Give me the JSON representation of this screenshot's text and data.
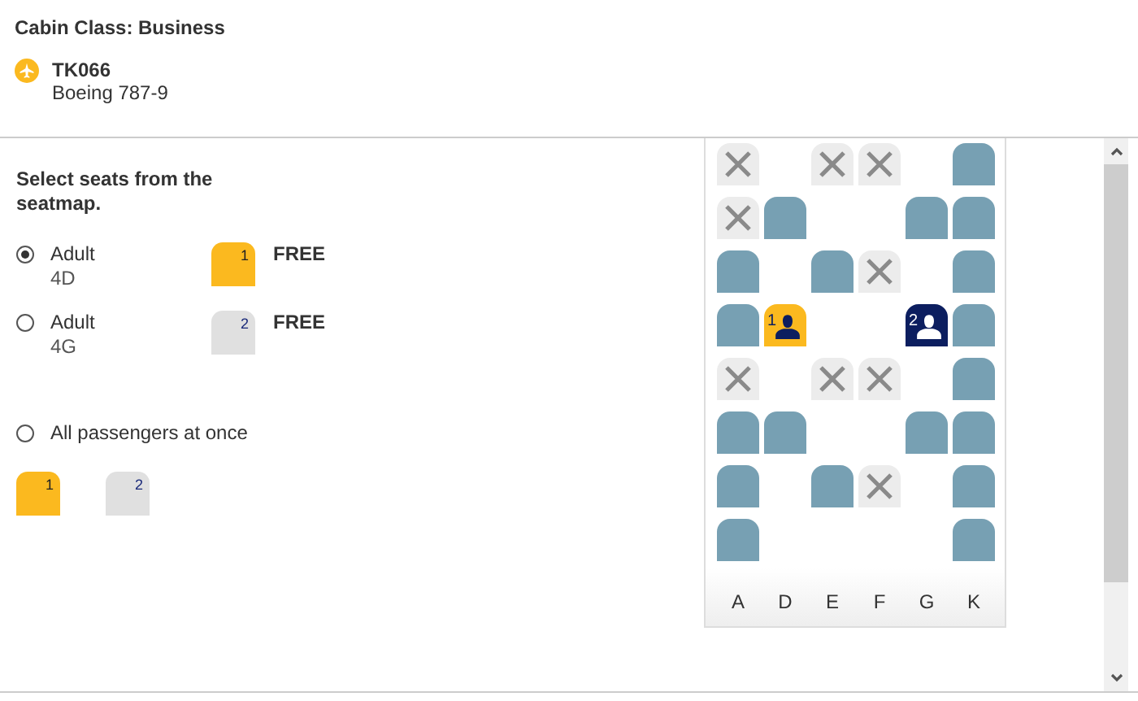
{
  "header": {
    "cabin_class": "Cabin Class: Business",
    "flight": {
      "number": "TK066",
      "aircraft": "Boeing 787-9"
    }
  },
  "instructions": "Select seats from the seatmap.",
  "passengers": [
    {
      "type": "Adult",
      "seat": "4D",
      "number": "1",
      "price": "FREE",
      "selected": true
    },
    {
      "type": "Adult",
      "seat": "4G",
      "number": "2",
      "price": "FREE",
      "selected": false
    }
  ],
  "all_passengers": {
    "label": "All passengers at once",
    "selected": false
  },
  "group_tiles": [
    {
      "number": "1",
      "selected": true
    },
    {
      "number": "2",
      "selected": false
    }
  ],
  "seatmap": {
    "seat_rows": [
      [
        {
          "kind": "occupied"
        },
        {
          "kind": "aisle"
        },
        {
          "kind": "occupied"
        },
        {
          "kind": "occupied"
        },
        {
          "kind": "aisle"
        },
        {
          "kind": "free"
        }
      ],
      [
        {
          "kind": "occupied"
        },
        {
          "kind": "free"
        },
        {
          "kind": "aisle"
        },
        {
          "kind": "aisle"
        },
        {
          "kind": "free"
        },
        {
          "kind": "free"
        }
      ],
      [
        {
          "kind": "free"
        },
        {
          "kind": "aisle"
        },
        {
          "kind": "free"
        },
        {
          "kind": "occupied"
        },
        {
          "kind": "aisle"
        },
        {
          "kind": "free"
        }
      ],
      [
        {
          "kind": "free"
        },
        {
          "kind": "assigned",
          "number": "1",
          "selected": true
        },
        {
          "kind": "aisle"
        },
        {
          "kind": "aisle"
        },
        {
          "kind": "assigned",
          "number": "2",
          "selected": false
        },
        {
          "kind": "free"
        }
      ],
      [
        {
          "kind": "occupied"
        },
        {
          "kind": "aisle"
        },
        {
          "kind": "occupied"
        },
        {
          "kind": "occupied"
        },
        {
          "kind": "aisle"
        },
        {
          "kind": "free"
        }
      ],
      [
        {
          "kind": "free"
        },
        {
          "kind": "free"
        },
        {
          "kind": "aisle"
        },
        {
          "kind": "aisle"
        },
        {
          "kind": "free"
        },
        {
          "kind": "free"
        }
      ],
      [
        {
          "kind": "free"
        },
        {
          "kind": "aisle"
        },
        {
          "kind": "free"
        },
        {
          "kind": "occupied"
        },
        {
          "kind": "aisle"
        },
        {
          "kind": "free"
        }
      ],
      [
        {
          "kind": "free"
        },
        {
          "kind": "aisle"
        },
        {
          "kind": "aisle"
        },
        {
          "kind": "aisle"
        },
        {
          "kind": "aisle"
        },
        {
          "kind": "free"
        }
      ]
    ],
    "column_letters": [
      "A",
      "D",
      "E",
      "F",
      "G",
      "K"
    ]
  }
}
